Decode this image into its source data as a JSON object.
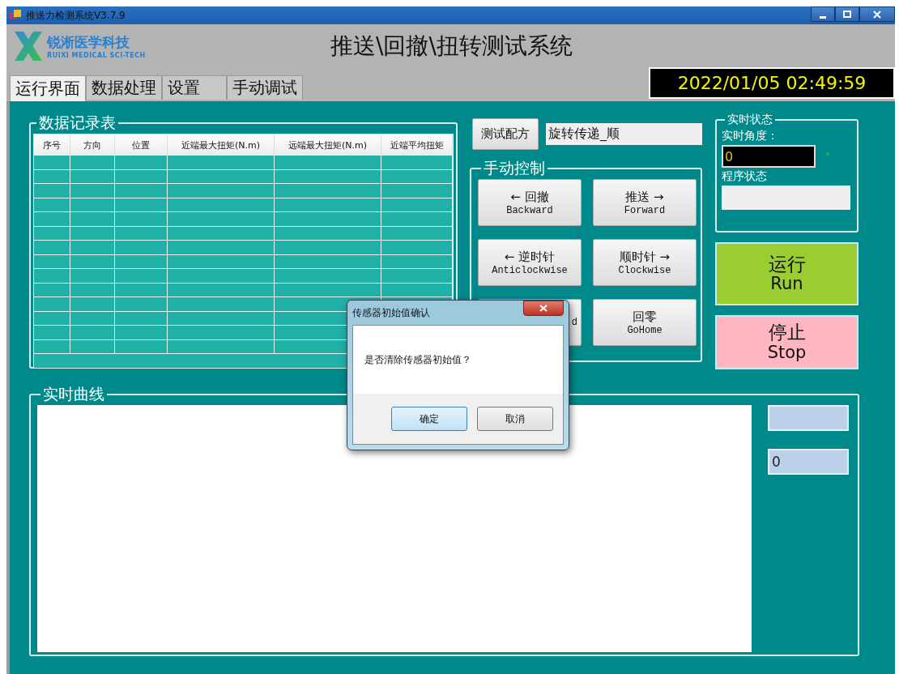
{
  "window": {
    "title": "推送力检测系统V3.7.9"
  },
  "header": {
    "company_name": "锐淅医学科技",
    "company_subtitle": "RUIXI MEDICAL SCI-TECH",
    "title": "推送\\回撤\\扭转测试系统",
    "datetime": "2022/01/05 02:49:59"
  },
  "tabs": [
    {
      "label": "运行界面",
      "selected": true
    },
    {
      "label": "数据处理",
      "selected": false
    },
    {
      "label": "设置",
      "selected": false
    },
    {
      "label": "手动调试",
      "selected": false
    }
  ],
  "data_table": {
    "title": "数据记录表",
    "columns": [
      "序号",
      "方向",
      "位置",
      "近端最大扭矩(N.m)",
      "远端最大扭矩(N.m)",
      "近端平均扭矩"
    ]
  },
  "recipe": {
    "button": "测试配方",
    "value": "旋转传递_顺"
  },
  "manual_control": {
    "title": "手动控制",
    "buttons": [
      {
        "label": "← 回撤",
        "sub": "Backward"
      },
      {
        "label": "推送 →",
        "sub": "Forward"
      },
      {
        "label": "← 逆时针",
        "sub": "Anticlockwise"
      },
      {
        "label": "顺时针 →",
        "sub": "Clockwise"
      },
      {
        "sub": "d"
      },
      {
        "label": "回零",
        "sub": "GoHome"
      }
    ]
  },
  "status": {
    "title": "实时状态",
    "angle_label": "实时角度：",
    "angle_value": "0",
    "angle_unit": "°",
    "program_label": "程序状态"
  },
  "run_button": {
    "label": "运行",
    "sub": "Run"
  },
  "stop_button": {
    "label": "停止",
    "sub": "Stop"
  },
  "curve": {
    "title": "实时曲线",
    "readout": "0"
  },
  "dialog": {
    "title": "传感器初始值确认",
    "message": "是否清除传感器初始值？",
    "buttons": [
      {
        "label": "确定",
        "selected": true
      },
      {
        "label": "取消",
        "selected": false
      }
    ]
  }
}
